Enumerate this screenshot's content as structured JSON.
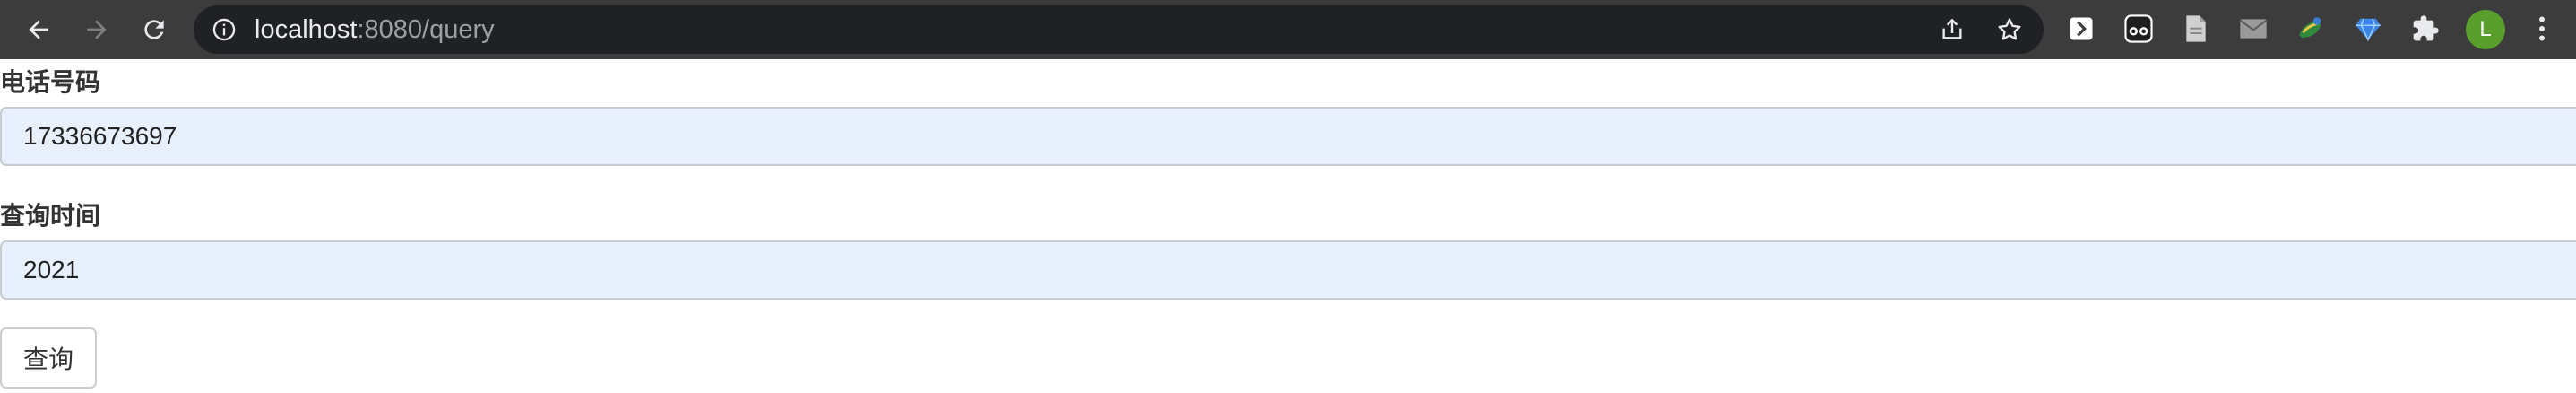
{
  "browser": {
    "url_host": "localhost",
    "url_rest": ":8080/query",
    "avatar_letter": "L",
    "extensions": [
      "tab-switch-extension",
      "glasses-extension",
      "document-extension",
      "mail-extension",
      "painting-extension",
      "gem-extension",
      "puzzle-extensions"
    ]
  },
  "form": {
    "phone": {
      "label": "电话号码",
      "value": "17336673697"
    },
    "query_time": {
      "label": "查询时间",
      "value": "2021"
    },
    "submit_label": "查询"
  },
  "colors": {
    "toolbar_bg": "#3c3c3c",
    "omnibox_bg": "#202124",
    "autofill_bg": "#e8f0fe",
    "avatar_bg": "#5a9e2e"
  }
}
